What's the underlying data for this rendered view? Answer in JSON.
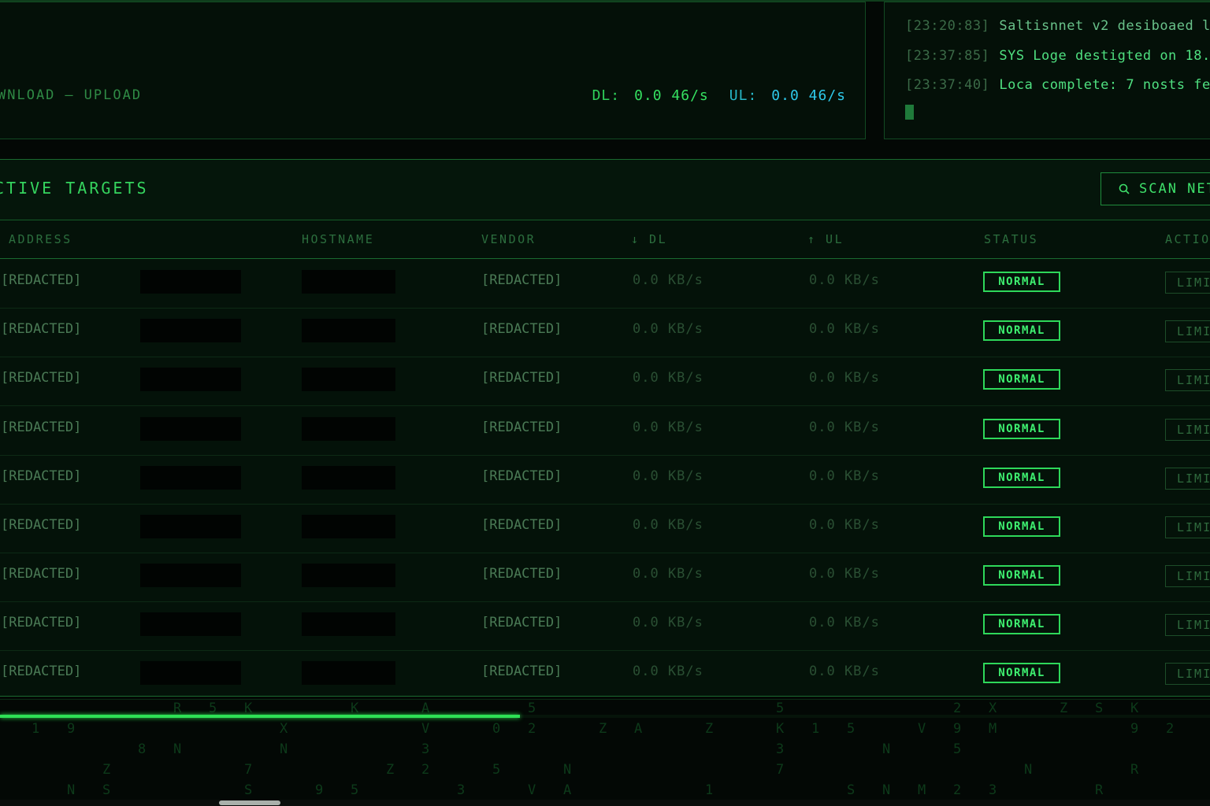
{
  "traffic": {
    "legend_download": "WNLOAD",
    "legend_separator": "—",
    "legend_upload": "UPLOAD",
    "dl_label": "DL:",
    "dl_value": "0.0 46/s",
    "ul_label": "UL:",
    "ul_value": "0.0 46/s"
  },
  "log": {
    "lines": [
      {
        "timestamp": "[23:20:83]",
        "message": "Saltisnnet v2 desiboaed l"
      },
      {
        "timestamp": "[23:37:85]",
        "message": "SYS Loge destigted on 18."
      },
      {
        "timestamp": "[23:37:40]",
        "message": "Loca complete: 7 nosts fe"
      }
    ]
  },
  "targets": {
    "title": "CTIVE TARGETS",
    "scan_button": "SCAN NET",
    "columns": {
      "ip": "ADDRESS",
      "hostname": "HOSTNAME",
      "vendor": "VENDOR",
      "dl": "↓ DL",
      "ul": "↑ UL",
      "status": "STATUS",
      "actions": "ACTIO"
    },
    "rows": [
      {
        "ip": "[REDACTED]",
        "vendor": "[REDACTED]",
        "dl": "0.0 KB/s",
        "ul": "0.0 KB/s",
        "status": "NORMAL",
        "action": "LIMIT"
      },
      {
        "ip": "[REDACTED]",
        "vendor": "[REDACTED]",
        "dl": "0.0 KB/s",
        "ul": "0.0 KB/s",
        "status": "NORMAL",
        "action": "LIMIT"
      },
      {
        "ip": "[REDACTED]",
        "vendor": "[REDACTED]",
        "dl": "0.0 KB/s",
        "ul": "0.0 KB/s",
        "status": "NORMAL",
        "action": "LIMIT"
      },
      {
        "ip": "[REDACTED]",
        "vendor": "[REDACTED]",
        "dl": "0.0 KB/s",
        "ul": "0.0 KB/s",
        "status": "NORMAL",
        "action": "LIMIT"
      },
      {
        "ip": "[REDACTED]",
        "vendor": "[REDACTED]",
        "dl": "0.0 KB/s",
        "ul": "0.0 KB/s",
        "status": "NORMAL",
        "action": "LIMIT"
      },
      {
        "ip": "[REDACTED]",
        "vendor": "[REDACTED]",
        "dl": "0.0 KB/s",
        "ul": "0.0 KB/s",
        "status": "NORMAL",
        "action": "LIMIT"
      },
      {
        "ip": "[REDACTED]",
        "vendor": "[REDACTED]",
        "dl": "0.0 KB/s",
        "ul": "0.0 KB/s",
        "status": "NORMAL",
        "action": "LIMIT"
      },
      {
        "ip": "[REDACTED]",
        "vendor": "[REDACTED]",
        "dl": "0.0 KB/s",
        "ul": "0.0 KB/s",
        "status": "NORMAL",
        "action": "LIMIT"
      },
      {
        "ip": "[REDACTED]",
        "vendor": "[REDACTED]",
        "dl": "0.0 KB/s",
        "ul": "0.0 KB/s",
        "status": "NORMAL",
        "action": "LIMIT"
      }
    ]
  },
  "scan_progress": 0.43,
  "colors": {
    "accent": "#2ee055",
    "ul_accent": "#2ec9ea",
    "background": "#030805",
    "border": "#1a6a30"
  },
  "icons": {
    "scan": "search-icon"
  }
}
